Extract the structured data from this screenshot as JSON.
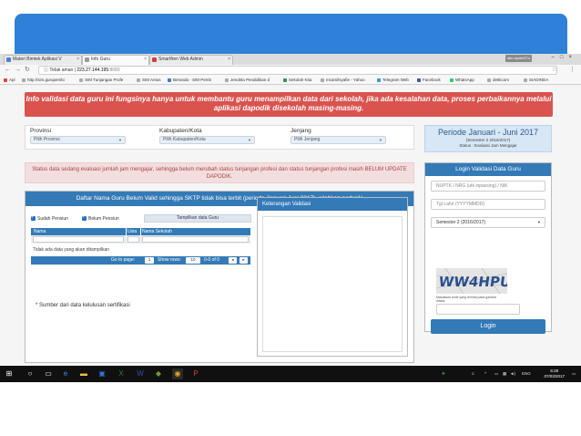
{
  "browser": {
    "tabs": [
      {
        "label": "Materi Bimtek Aplikasi V",
        "active": false
      },
      {
        "label": "Info Guru",
        "active": true
      },
      {
        "label": "Smartfren Web Admin",
        "active": false
      }
    ],
    "user_badge": "aku.nyotoGTu",
    "address": {
      "security": "Tidak aman",
      "host": "223.27.144.195",
      "port": ":8083"
    },
    "bookmarks": [
      "Apl",
      "http://sim.gurupembi",
      "SIM Tunjangan Profe",
      "SIM Antus",
      "Beranda - SIM Pemb",
      "Jendela Pendidikan d",
      "Sekolah Kita",
      "mcamilsyafie - Yahoo",
      "Telegram Web",
      "Facebook",
      "WhatsApp",
      "detikcom",
      "SIADINDA"
    ]
  },
  "page": {
    "alert_red": "Info validasi data guru ini fungsinya hanya untuk membantu guru menampilkan data dari sekolah, jika ada kesalahan data, proses perbaikannya melalui aplikasi dapodik disekolah masing-masing.",
    "filters": [
      {
        "label": "Provinsi",
        "value": "Pilih Provinsi"
      },
      {
        "label": "Kabupaten/Kota",
        "value": "Pilih Kabupaten/Kota"
      },
      {
        "label": "Jenjang",
        "value": "Pilih Jenjang"
      }
    ],
    "period": {
      "title": "Periode Januari - Juni 2017",
      "semester": "(Semester 2 2016/2017)",
      "status": "Status : Evaluasi Jam Mengajar"
    },
    "alert_pink": "Status data sedang evaluasi jumlah jam mengajar, sehingga belum merubah status tunjangan profesi dan status tunjangan profesi masih BELUM UPDATE DAPODIK.",
    "list": {
      "title": "Daftar Nama Guru Belum Valid sehingga SKTP tidak bisa terbit (periode Januari-Juni 2017), silahkan perbaiki",
      "checkbox_pensiun": "Sudah Pensiun",
      "checkbox_belum": "Belum Pensiun",
      "button": "Tampilkan data Guru",
      "columns": [
        "Nama",
        "Usia",
        "Nama Sekolah"
      ],
      "empty": "Tidak ada data yang akan ditampilkan",
      "pager_goto": "Go to page:",
      "pager_page": "1",
      "pager_show": "Show rows:",
      "pager_rows": "10",
      "pager_range": "0-0 of 0",
      "source_note": "* Sumber dari data kelulusan sertifikasi"
    },
    "keterangan": {
      "title": "Keterangan Validasi"
    },
    "login": {
      "title": "Login Validasi Data Guru",
      "nuptk_placeholder": "NUPTK / NRG (utk inpassing) / NIK",
      "dob_placeholder": "Tgl Lahir (YYYYMMDD)",
      "semester": "Semester 2 (2016/2017)",
      "captcha_text": "WW4HPU",
      "captcha_caption": "Masukkan kode yang terlihat pada gambar diatas",
      "button": "Login"
    }
  },
  "taskbar": {
    "language": "ENG",
    "time": "6:28",
    "date": "07/03/2017"
  }
}
